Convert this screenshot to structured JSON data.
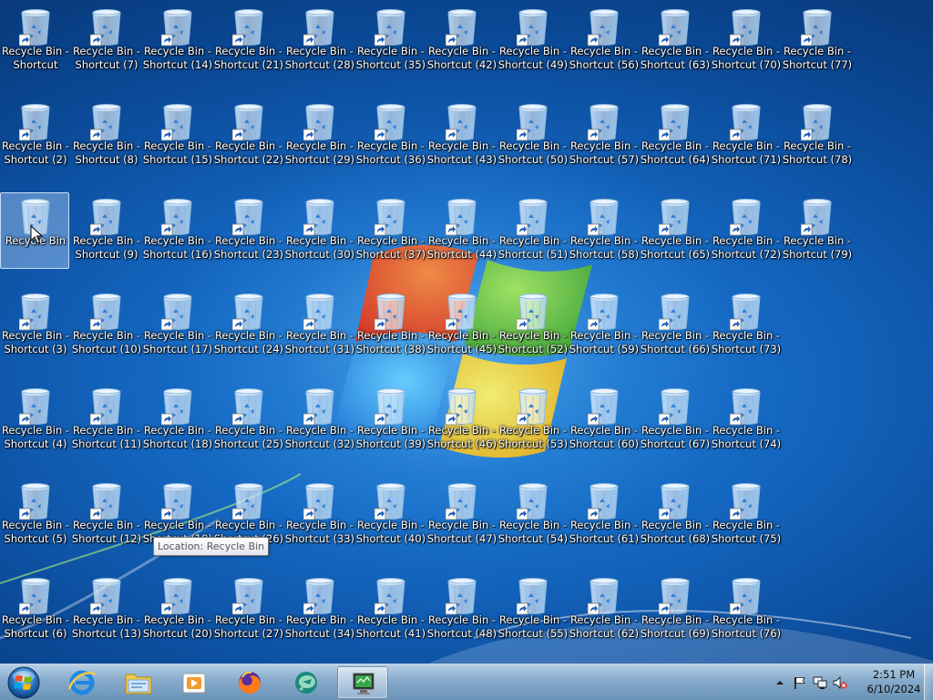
{
  "desktop": {
    "wallpaper": "windows-7-default",
    "icon_name": "recycle-bin-icon",
    "columns": 12,
    "rows": 7,
    "selected_indices": [
      2,
      83
    ],
    "icons": [
      {
        "l1": "Recycle Bin -",
        "l2": "Shortcut",
        "shortcut": true
      },
      {
        "l1": "Recycle Bin -",
        "l2": "Shortcut (2)",
        "shortcut": true
      },
      {
        "l1": "Recycle Bin",
        "l2": "",
        "shortcut": false
      },
      {
        "l1": "Recycle Bin -",
        "l2": "Shortcut (3)",
        "shortcut": true
      },
      {
        "l1": "Recycle Bin -",
        "l2": "Shortcut (4)",
        "shortcut": true
      },
      {
        "l1": "Recycle Bin -",
        "l2": "Shortcut (5)",
        "shortcut": true
      },
      {
        "l1": "Recycle Bin -",
        "l2": "Shortcut (6)",
        "shortcut": true
      },
      {
        "l1": "Recycle Bin -",
        "l2": "Shortcut (7)",
        "shortcut": true
      },
      {
        "l1": "Recycle Bin -",
        "l2": "Shortcut (8)",
        "shortcut": true
      },
      {
        "l1": "Recycle Bin -",
        "l2": "Shortcut (9)",
        "shortcut": true
      },
      {
        "l1": "Recycle Bin -",
        "l2": "Shortcut (10)",
        "shortcut": true
      },
      {
        "l1": "Recycle Bin -",
        "l2": "Shortcut (11)",
        "shortcut": true
      },
      {
        "l1": "Recycle Bin -",
        "l2": "Shortcut (12)",
        "shortcut": true
      },
      {
        "l1": "Recycle Bin -",
        "l2": "Shortcut (13)",
        "shortcut": true
      },
      {
        "l1": "Recycle Bin -",
        "l2": "Shortcut (14)",
        "shortcut": true
      },
      {
        "l1": "Recycle Bin -",
        "l2": "Shortcut (15)",
        "shortcut": true
      },
      {
        "l1": "Recycle Bin -",
        "l2": "Shortcut (16)",
        "shortcut": true
      },
      {
        "l1": "Recycle Bin -",
        "l2": "Shortcut (17)",
        "shortcut": true
      },
      {
        "l1": "Recycle Bin -",
        "l2": "Shortcut (18)",
        "shortcut": true
      },
      {
        "l1": "Recycle Bin -",
        "l2": "Shortcut (19)",
        "shortcut": true
      },
      {
        "l1": "Recycle Bin -",
        "l2": "Shortcut (20)",
        "shortcut": true
      },
      {
        "l1": "Recycle Bin -",
        "l2": "Shortcut (21)",
        "shortcut": true
      },
      {
        "l1": "Recycle Bin -",
        "l2": "Shortcut (22)",
        "shortcut": true
      },
      {
        "l1": "Recycle Bin -",
        "l2": "Shortcut (23)",
        "shortcut": true
      },
      {
        "l1": "Recycle Bin -",
        "l2": "Shortcut (24)",
        "shortcut": true
      },
      {
        "l1": "Recycle Bin -",
        "l2": "Shortcut (25)",
        "shortcut": true
      },
      {
        "l1": "Recycle Bin -",
        "l2": "Shortcut (26)",
        "shortcut": true
      },
      {
        "l1": "Recycle Bin -",
        "l2": "Shortcut (27)",
        "shortcut": true
      },
      {
        "l1": "Recycle Bin -",
        "l2": "Shortcut (28)",
        "shortcut": true
      },
      {
        "l1": "Recycle Bin -",
        "l2": "Shortcut (29)",
        "shortcut": true
      },
      {
        "l1": "Recycle Bin -",
        "l2": "Shortcut (30)",
        "shortcut": true
      },
      {
        "l1": "Recycle Bin -",
        "l2": "Shortcut (31)",
        "shortcut": true
      },
      {
        "l1": "Recycle Bin -",
        "l2": "Shortcut (32)",
        "shortcut": true
      },
      {
        "l1": "Recycle Bin -",
        "l2": "Shortcut (33)",
        "shortcut": true
      },
      {
        "l1": "Recycle Bin -",
        "l2": "Shortcut (34)",
        "shortcut": true
      },
      {
        "l1": "Recycle Bin -",
        "l2": "Shortcut (35)",
        "shortcut": true
      },
      {
        "l1": "Recycle Bin -",
        "l2": "Shortcut (36)",
        "shortcut": true
      },
      {
        "l1": "Recycle Bin -",
        "l2": "Shortcut (37)",
        "shortcut": true
      },
      {
        "l1": "Recycle Bin -",
        "l2": "Shortcut (38)",
        "shortcut": true
      },
      {
        "l1": "Recycle Bin -",
        "l2": "Shortcut (39)",
        "shortcut": true
      },
      {
        "l1": "Recycle Bin -",
        "l2": "Shortcut (40)",
        "shortcut": true
      },
      {
        "l1": "Recycle Bin -",
        "l2": "Shortcut (41)",
        "shortcut": true
      },
      {
        "l1": "Recycle Bin -",
        "l2": "Shortcut (42)",
        "shortcut": true
      },
      {
        "l1": "Recycle Bin -",
        "l2": "Shortcut (43)",
        "shortcut": true
      },
      {
        "l1": "Recycle Bin -",
        "l2": "Shortcut (44)",
        "shortcut": true
      },
      {
        "l1": "Recycle Bin -",
        "l2": "Shortcut (45)",
        "shortcut": true
      },
      {
        "l1": "Recycle Bin -",
        "l2": "Shortcut (46)",
        "shortcut": true
      },
      {
        "l1": "Recycle Bin -",
        "l2": "Shortcut (47)",
        "shortcut": true
      },
      {
        "l1": "Recycle Bin -",
        "l2": "Shortcut (48)",
        "shortcut": true
      },
      {
        "l1": "Recycle Bin -",
        "l2": "Shortcut (49)",
        "shortcut": true
      },
      {
        "l1": "Recycle Bin -",
        "l2": "Shortcut (50)",
        "shortcut": true
      },
      {
        "l1": "Recycle Bin -",
        "l2": "Shortcut (51)",
        "shortcut": true
      },
      {
        "l1": "Recycle Bin -",
        "l2": "Shortcut (52)",
        "shortcut": true
      },
      {
        "l1": "Recycle Bin -",
        "l2": "Shortcut (53)",
        "shortcut": true
      },
      {
        "l1": "Recycle Bin -",
        "l2": "Shortcut (54)",
        "shortcut": true
      },
      {
        "l1": "Recycle Bin -",
        "l2": "Shortcut (55)",
        "shortcut": true
      },
      {
        "l1": "Recycle Bin -",
        "l2": "Shortcut (56)",
        "shortcut": true
      },
      {
        "l1": "Recycle Bin -",
        "l2": "Shortcut (57)",
        "shortcut": true
      },
      {
        "l1": "Recycle Bin -",
        "l2": "Shortcut (58)",
        "shortcut": true
      },
      {
        "l1": "Recycle Bin -",
        "l2": "Shortcut (59)",
        "shortcut": true
      },
      {
        "l1": "Recycle Bin -",
        "l2": "Shortcut (60)",
        "shortcut": true
      },
      {
        "l1": "Recycle Bin -",
        "l2": "Shortcut (61)",
        "shortcut": true
      },
      {
        "l1": "Recycle Bin -",
        "l2": "Shortcut (62)",
        "shortcut": true
      },
      {
        "l1": "Recycle Bin -",
        "l2": "Shortcut (63)",
        "shortcut": true
      },
      {
        "l1": "Recycle Bin -",
        "l2": "Shortcut (64)",
        "shortcut": true
      },
      {
        "l1": "Recycle Bin -",
        "l2": "Shortcut (65)",
        "shortcut": true
      },
      {
        "l1": "Recycle Bin -",
        "l2": "Shortcut (66)",
        "shortcut": true
      },
      {
        "l1": "Recycle Bin -",
        "l2": "Shortcut (67)",
        "shortcut": true
      },
      {
        "l1": "Recycle Bin -",
        "l2": "Shortcut (68)",
        "shortcut": true
      },
      {
        "l1": "Recycle Bin -",
        "l2": "Shortcut (69)",
        "shortcut": true
      },
      {
        "l1": "Recycle Bin -",
        "l2": "Shortcut (70)",
        "shortcut": true
      },
      {
        "l1": "Recycle Bin -",
        "l2": "Shortcut (71)",
        "shortcut": true
      },
      {
        "l1": "Recycle Bin -",
        "l2": "Shortcut (72)",
        "shortcut": true
      },
      {
        "l1": "Recycle Bin -",
        "l2": "Shortcut (73)",
        "shortcut": true
      },
      {
        "l1": "Recycle Bin -",
        "l2": "Shortcut (74)",
        "shortcut": true
      },
      {
        "l1": "Recycle Bin -",
        "l2": "Shortcut (75)",
        "shortcut": true
      },
      {
        "l1": "Recycle Bin -",
        "l2": "Shortcut (76)",
        "shortcut": true
      },
      {
        "l1": "Recycle Bin -",
        "l2": "Shortcut (77)",
        "shortcut": true
      },
      {
        "l1": "Recycle Bin -",
        "l2": "Shortcut (78)",
        "shortcut": true
      },
      {
        "l1": "Recycle Bin -",
        "l2": "Shortcut (79)",
        "shortcut": true
      },
      null,
      null,
      null,
      null
    ]
  },
  "tooltip": {
    "text": "Location: Recycle Bin"
  },
  "taskbar": {
    "start_icon": "windows-start-orb-icon",
    "items": [
      {
        "name": "internet-explorer",
        "icon": "internet-explorer-icon",
        "active": false
      },
      {
        "name": "windows-explorer",
        "icon": "folder-icon",
        "active": false
      },
      {
        "name": "media-player",
        "icon": "media-player-icon",
        "active": false
      },
      {
        "name": "firefox",
        "icon": "firefox-icon",
        "active": false
      },
      {
        "name": "app-teal",
        "icon": "teal-app-icon",
        "active": false
      },
      {
        "name": "remote-app",
        "icon": "monitor-app-icon",
        "active": true
      }
    ],
    "tray": {
      "icons": [
        "show-hidden-icons-arrow-icon",
        "action-center-flag-icon",
        "network-icon",
        "volume-muted-icon"
      ],
      "time": "2:51 PM",
      "date": "6/10/2024"
    }
  }
}
